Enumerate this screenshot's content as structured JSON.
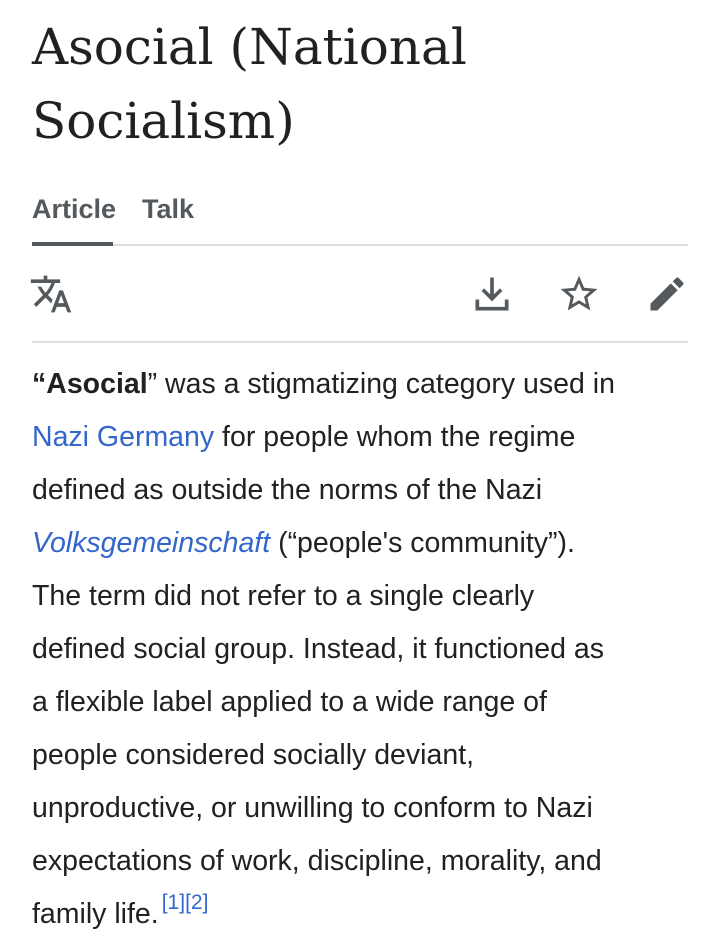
{
  "page": {
    "title_line1": "Asocial (National",
    "title_line2": "Socialism)"
  },
  "tabs": [
    {
      "label": "Article",
      "selected": true
    },
    {
      "label": "Talk",
      "selected": false
    }
  ],
  "toolbar": {
    "icons": [
      "translate-icon",
      "download-icon",
      "star-icon",
      "edit-icon"
    ]
  },
  "article": {
    "lead_open_quote": "“",
    "lead_term": "Asocial",
    "lead_close_quote_rest": "” was a stigmatizing category used in",
    "link_nazi_germany": "Nazi Germany",
    "after_link1": " for people whom the regime",
    "line3": "defined as outside the norms of the Nazi",
    "link_volksgemeinschaft": "Volksgemeinschaft",
    "after_link2": " (“people's community”).",
    "line5": "The term did not refer to a single clearly",
    "line6": "defined social group. Instead, it functioned as",
    "line7": "a flexible label applied to a wide range of",
    "line8": "people considered socially deviant,",
    "line9": "unproductive, or unwilling to conform to Nazi",
    "line10": "expectations of work, discipline, morality, and",
    "line11": "family life.",
    "ref1": "[1]",
    "ref2": "[2]"
  },
  "colors": {
    "link": "#3366cc",
    "text": "#202122",
    "tab_text": "#54595d",
    "divider": "#dcdee2"
  }
}
